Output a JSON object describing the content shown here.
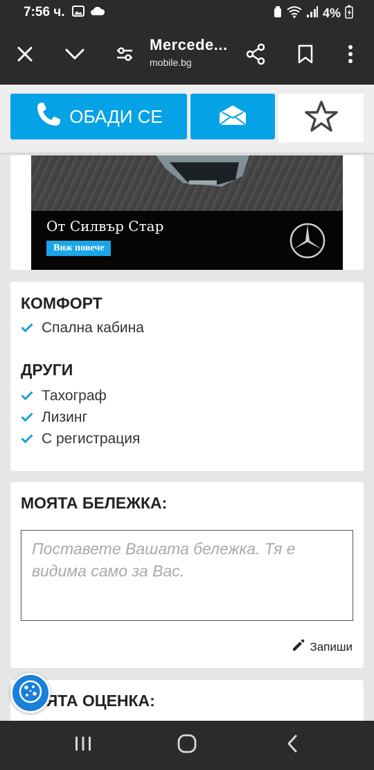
{
  "status_bar": {
    "time": "7:56 ч.",
    "battery": "4%"
  },
  "browser": {
    "title": "Mercede...",
    "domain": "mobile.bg"
  },
  "actions": {
    "call_label": "ОБАДИ СЕ"
  },
  "ad": {
    "headline": "От Силвър Стар",
    "cta": "Виж повече"
  },
  "features": {
    "sections": [
      {
        "title": "КОМФОРТ",
        "items": [
          "Спална кабина"
        ]
      },
      {
        "title": "ДРУГИ",
        "items": [
          "Тахограф",
          "Лизинг",
          "С регистрация"
        ]
      }
    ]
  },
  "note": {
    "title": "МОЯТА БЕЛЕЖКА:",
    "placeholder": "Поставете Вашата бележка. Тя е видима само за Вас.",
    "save_label": "Запиши"
  },
  "rating": {
    "title": "МОЯТА ОЦЕНКА:"
  },
  "colors": {
    "accent": "#06a2e6",
    "bar": "#2b2b2b",
    "check": "#1a9fd9"
  },
  "icons": [
    "phone-icon",
    "envelope-icon",
    "star-icon",
    "close-icon",
    "chevron-down-icon",
    "filter-icon",
    "share-icon",
    "bookmark-icon",
    "more-icon",
    "pencil-icon",
    "check-icon",
    "cookie-icon",
    "mercedes-logo"
  ]
}
